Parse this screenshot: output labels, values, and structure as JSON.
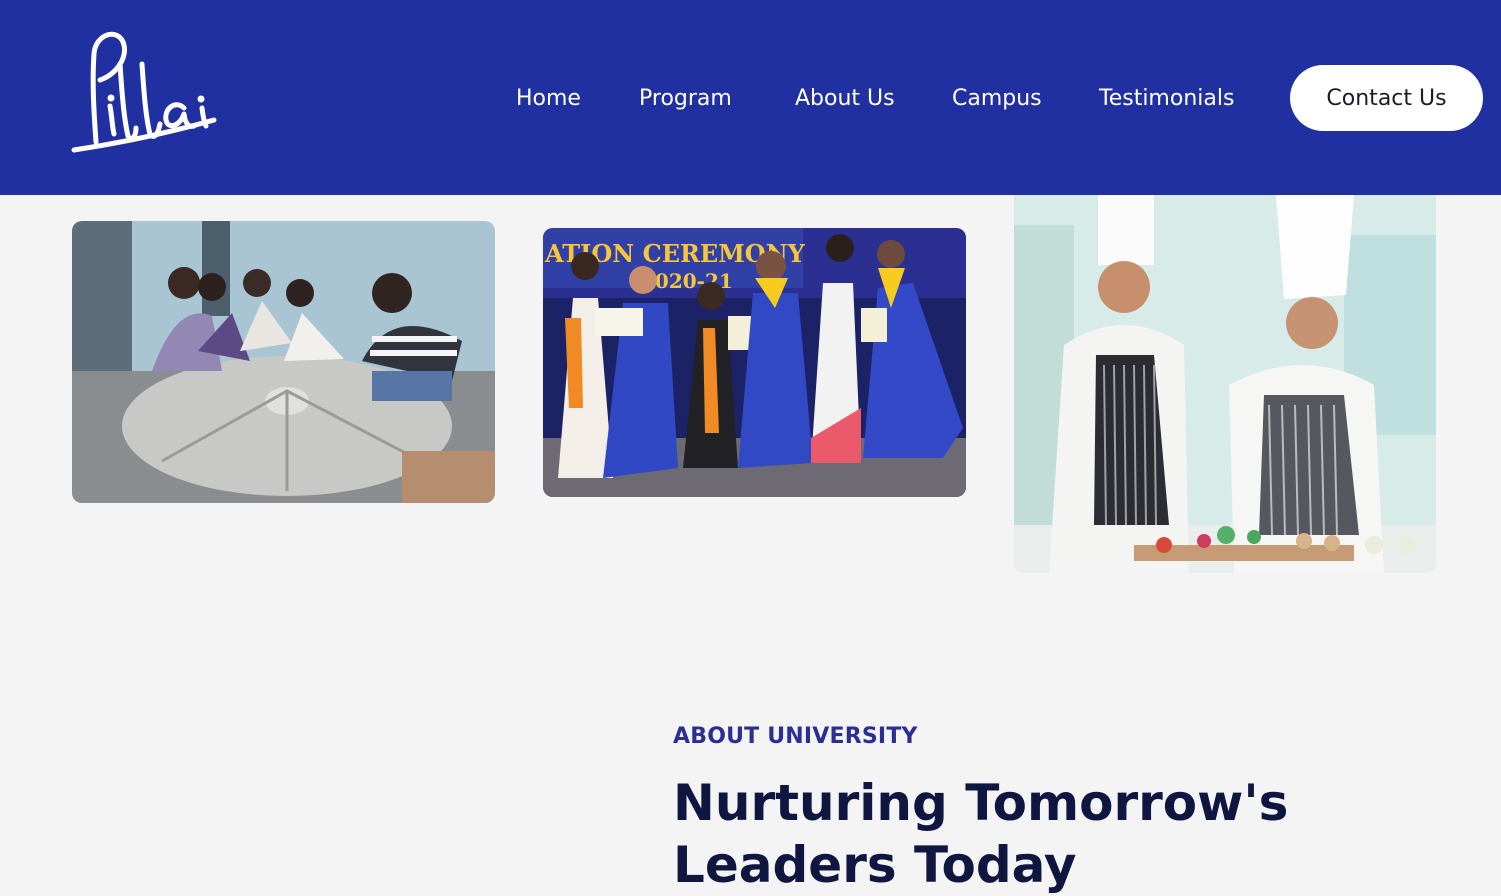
{
  "brand": {
    "logo_text": "Pillai"
  },
  "nav": {
    "items": [
      {
        "label": "Home"
      },
      {
        "label": "Program"
      },
      {
        "label": "About Us"
      },
      {
        "label": "Campus"
      },
      {
        "label": "Testimonials"
      }
    ],
    "contact_label": "Contact Us"
  },
  "gallery": {
    "photos": [
      {
        "subject": "students-sculpting-stone"
      },
      {
        "subject": "graduation-ceremony",
        "banner_text": "ATION CEREMONY",
        "banner_year": "2020-21"
      },
      {
        "subject": "culinary-chefs-cooking"
      }
    ]
  },
  "about": {
    "eyebrow": "ABOUT UNIVERSITY",
    "headline": "Nurturing Tomorrow's Leaders Today"
  },
  "colors": {
    "header_bg": "#2130a1",
    "page_bg": "#f4f4f4",
    "eyebrow": "#2a2f93",
    "headline": "#0f1640"
  }
}
